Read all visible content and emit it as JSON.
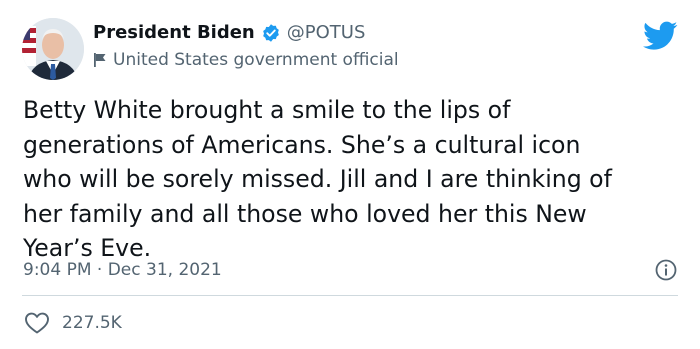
{
  "author": {
    "display_name": "President Biden",
    "handle": "@POTUS",
    "account_label": "United States government official",
    "verified_icon": "verified-badge-icon",
    "label_icon": "flag-icon"
  },
  "tweet": {
    "text": "Betty White brought a smile to the lips of\ngenerations of Americans. She’s a cultural icon\nwho will be sorely missed. Jill and I are thinking of\nher family and all those who loved her this New\nYear’s Eve.",
    "timestamp": "9:04 PM · Dec 31, 2021"
  },
  "engagement": {
    "likes": "227.5K",
    "like_icon": "heart-icon"
  },
  "colors": {
    "brand_blue": "#1d9bf0",
    "text_primary": "#0f1419",
    "text_secondary": "#536471",
    "divider": "#cfd9de"
  }
}
